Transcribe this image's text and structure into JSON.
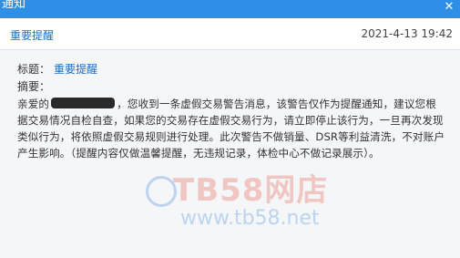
{
  "window": {
    "title": "通知",
    "close_icon": "close-icon"
  },
  "header": {
    "subject": "重要提醒",
    "timestamp": "2021-4-13 19:42"
  },
  "message": {
    "title_label": "标题：",
    "title_value": "重要提醒",
    "summary_label": "摘要：",
    "body_prefix": "亲爱的",
    "body_rest": "，您收到一条虚假交易警告消息，该警告仅作为提醒通知，建议您根据交易情况自检自查，如果您的交易存在虚假交易行为，请立即停止该行为，一旦再次发现类似行为，将依照虚假交易规则进行处理。此次警告不做销量、DSR等利益清洗，不对账户产生影响。（提醒内容仅做温馨提醒，无违规记录，体检中心不做记录展示）。"
  },
  "watermark": {
    "brand": "TB58网店",
    "url": "www.tb58.net"
  }
}
